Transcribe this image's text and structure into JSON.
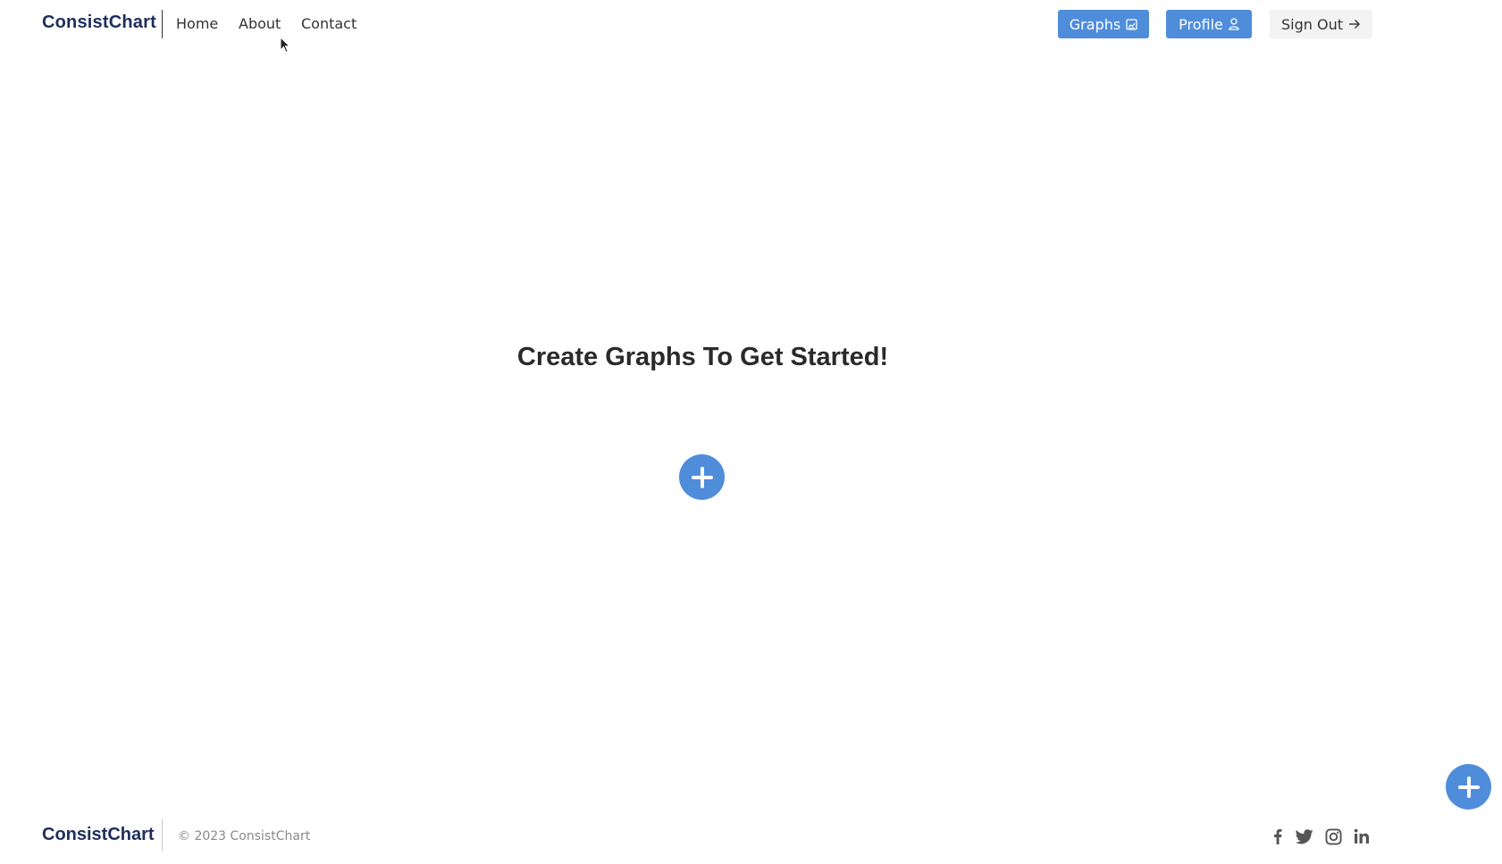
{
  "header": {
    "brand": "ConsistChart",
    "nav": [
      {
        "label": "Home"
      },
      {
        "label": "About"
      },
      {
        "label": "Contact"
      }
    ],
    "buttons": {
      "graphs": {
        "label": "Graphs",
        "icon": "chart-icon"
      },
      "profile": {
        "label": "Profile",
        "icon": "person-icon"
      },
      "signout": {
        "label": "Sign Out",
        "icon": "arrow-right-icon"
      }
    }
  },
  "main": {
    "headline": "Create Graphs To Get Started!",
    "add_button_icon": "plus-icon"
  },
  "footer": {
    "brand": "ConsistChart",
    "copyright": "© 2023 ConsistChart",
    "social": [
      "facebook-icon",
      "twitter-icon",
      "instagram-icon",
      "linkedin-icon"
    ]
  },
  "floating_add_button_icon": "plus-icon",
  "colors": {
    "accent": "#4f8ddb",
    "brand_text": "#1e2e5c",
    "muted_text": "#8a8a8a",
    "light_button": "#f3f3f3"
  }
}
